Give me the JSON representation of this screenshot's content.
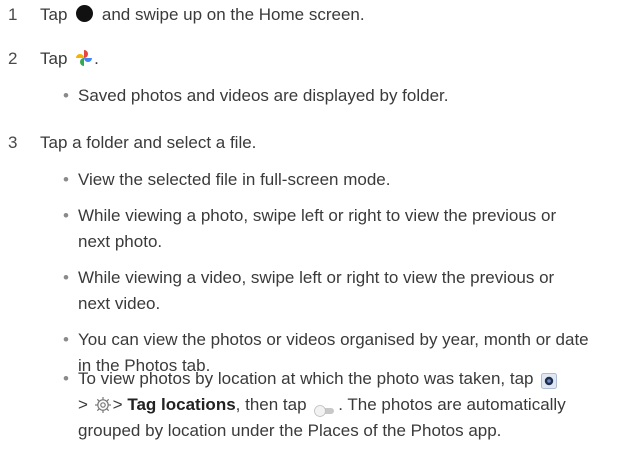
{
  "steps": [
    {
      "number": "1",
      "text_a": "Tap",
      "text_b": "and swipe up on the Home screen."
    },
    {
      "number": "2",
      "text_a": "Tap",
      "text_b": "."
    },
    {
      "number": "3",
      "text": "Tap a folder and select a file."
    }
  ],
  "step2_bullets": [
    "Saved photos and videos are displayed by folder."
  ],
  "step3_bullets": {
    "b1": "View the selected file in full-screen mode.",
    "b2_line1": "While viewing a photo, swipe left or right to view the previous or",
    "b2_line2": "next photo.",
    "b3_line1": "While viewing a video, swipe left or right to view the previous or",
    "b3_line2": "next video.",
    "b4_line1": "You can view the photos or videos organised by year, month or date",
    "b4_line2": "in the Photos tab.",
    "b5_a": "To view photos by location at which the photo was taken, tap",
    "b5_gt1": ">",
    "b5_gt2": ">",
    "b5_bold": "Tag locations",
    "b5_b": ", then tap",
    "b5_c": ". The photos are automatically",
    "b5_line3": "grouped by location under the Places of the Photos app."
  },
  "bullet_char": "•",
  "icons": {
    "home_dot": "home-button-icon",
    "photos": "photos-pinwheel-icon",
    "camera": "camera-icon",
    "gear": "settings-gear-icon",
    "toggle": "toggle-switch-icon"
  },
  "colors": {
    "text": "#3a3a3a",
    "bullet": "#8a8a8a",
    "pin_red": "#e8453c",
    "pin_yellow": "#f6b400",
    "pin_green": "#34a853",
    "pin_blue": "#4285f4"
  }
}
